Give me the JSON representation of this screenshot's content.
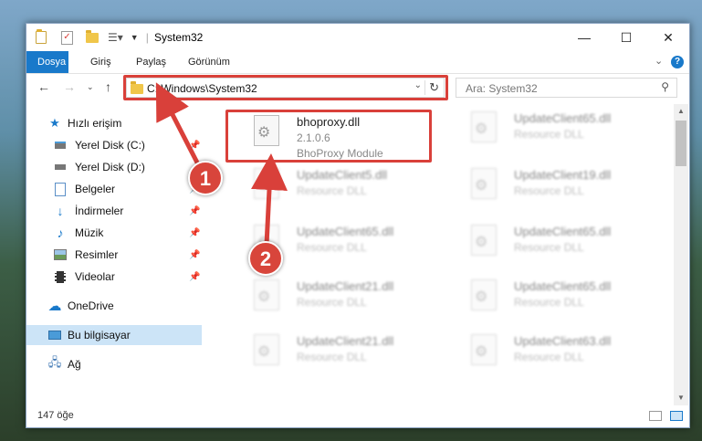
{
  "window": {
    "title": "System32",
    "controls": {
      "minimize": "—",
      "maximize": "☐",
      "close": "✕"
    }
  },
  "ribbon": {
    "tabs": [
      "Dosya",
      "Giriş",
      "Paylaş",
      "Görünüm"
    ],
    "active_tab": "Dosya",
    "expand_icon": "chevron-down-icon",
    "help_label": "?"
  },
  "address": {
    "path": "C:\\Windows\\System32",
    "search_placeholder": "Ara: System32"
  },
  "sidebar": {
    "items": [
      {
        "label": "Hızlı erişim",
        "icon": "star-icon"
      },
      {
        "label": "Yerel Disk (C:)",
        "icon": "drive-icon"
      },
      {
        "label": "Yerel Disk (D:)",
        "icon": "drive-icon"
      },
      {
        "label": "Belgeler",
        "icon": "document-icon"
      },
      {
        "label": "İndirmeler",
        "icon": "download-icon"
      },
      {
        "label": "Müzik",
        "icon": "music-icon"
      },
      {
        "label": "Resimler",
        "icon": "pictures-icon"
      },
      {
        "label": "Videolar",
        "icon": "video-icon"
      },
      {
        "label": "OneDrive",
        "icon": "cloud-icon"
      },
      {
        "label": "Bu bilgisayar",
        "icon": "computer-icon"
      },
      {
        "label": "Ağ",
        "icon": "network-icon"
      }
    ],
    "selected": "Bu bilgisayar"
  },
  "files": [
    {
      "name": "bhoproxy.dll",
      "version": "2.1.0.6",
      "description": "BhoProxy Module",
      "highlighted": true
    },
    {
      "name": "UpdateClient65.dll",
      "description": "Resource DLL"
    },
    {
      "name": "UpdateClient5.dll",
      "description": "Resource DLL"
    },
    {
      "name": "UpdateClient19.dll",
      "description": "Resource DLL"
    },
    {
      "name": "UpdateClient65.dll",
      "description": "Resource DLL"
    },
    {
      "name": "UpdateClient65.dll",
      "description": "Resource DLL"
    },
    {
      "name": "UpdateClient21.dll",
      "description": "Resource DLL"
    },
    {
      "name": "UpdateClient65.dll",
      "description": "Resource DLL"
    },
    {
      "name": "UpdateClient21.dll",
      "description": "Resource DLL"
    },
    {
      "name": "UpdateClient63.dll",
      "description": "Resource DLL"
    }
  ],
  "status": {
    "count": "147 öğe"
  },
  "annotations": {
    "step1": "1",
    "step2": "2",
    "color": "#d9403a"
  }
}
